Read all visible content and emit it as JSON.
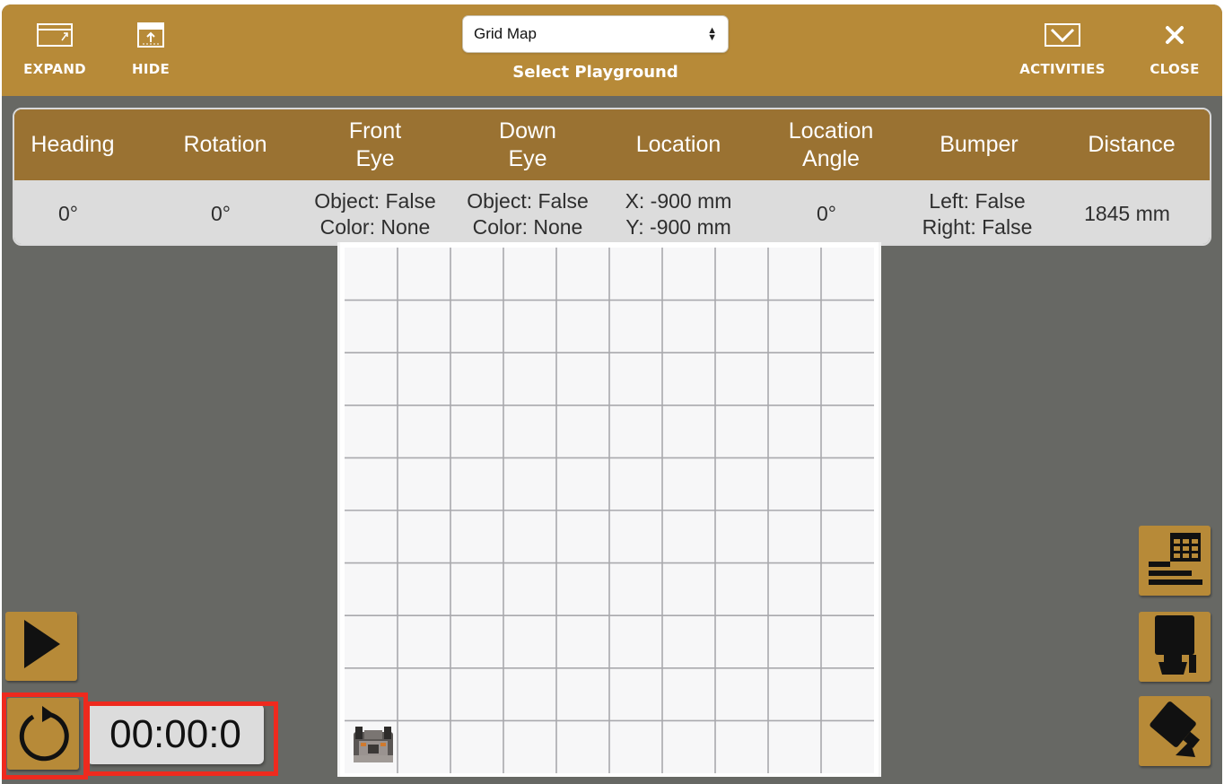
{
  "toolbar": {
    "expand_label": "EXPAND",
    "hide_label": "HIDE",
    "activities_label": "ACTIVITIES",
    "close_label": "CLOSE",
    "playground_select_value": "Grid Map",
    "playground_caption": "Select Playground"
  },
  "sensors": {
    "headers": [
      {
        "label": "Heading"
      },
      {
        "label": "Rotation"
      },
      {
        "label": "Front\nEye"
      },
      {
        "label": "Down\nEye"
      },
      {
        "label": "Location"
      },
      {
        "label": "Location\nAngle"
      },
      {
        "label": "Bumper"
      },
      {
        "label": "Distance"
      }
    ],
    "values": [
      {
        "text": "0°"
      },
      {
        "text": "0°"
      },
      {
        "text": "Object: False\nColor: None"
      },
      {
        "text": "Object: False\nColor: None"
      },
      {
        "text": "X: -900 mm\nY: -900 mm"
      },
      {
        "text": "0°"
      },
      {
        "text": "Left: False\nRight: False"
      },
      {
        "text": "1845 mm"
      }
    ]
  },
  "playground": {
    "name": "Grid Map",
    "grid_columns": 10,
    "grid_rows": 10,
    "robot_icon": "vr-robot-icon"
  },
  "controls": {
    "timer": "00:00:0",
    "play_icon": "play-icon",
    "reset_icon": "reset-icon",
    "data_panel_icon": "data-panel-icon",
    "top_camera_icon": "top-camera-icon",
    "chase_camera_icon": "chase-camera-icon"
  },
  "colors": {
    "toolbar_bg": "#b78a38",
    "header_bg": "#9a7232",
    "values_bg": "#dcdcdc",
    "workspace_bg": "#676864",
    "highlight": "#ee2a1e"
  }
}
